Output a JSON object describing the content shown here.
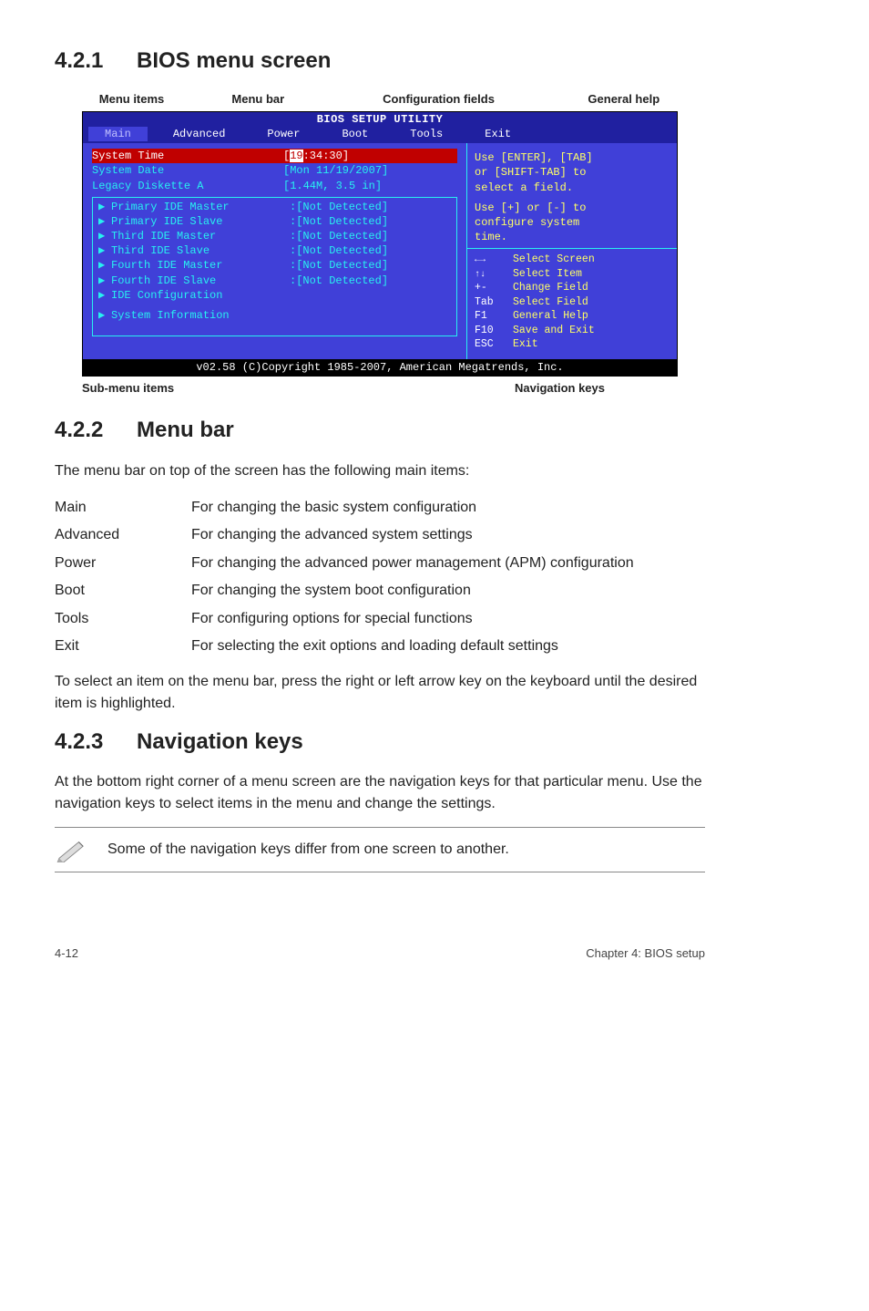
{
  "sections": {
    "s1": {
      "num": "4.2.1",
      "title": "BIOS menu screen"
    },
    "s2": {
      "num": "4.2.2",
      "title": "Menu bar"
    },
    "s3": {
      "num": "4.2.3",
      "title": "Navigation keys"
    }
  },
  "diagram_labels": {
    "menu_items": "Menu items",
    "menu_bar": "Menu bar",
    "config_fields": "Configuration fields",
    "general_help": "General help",
    "sub_menu_items": "Sub-menu items",
    "nav_keys": "Navigation keys"
  },
  "bios": {
    "header": "BIOS SETUP UTILITY",
    "menubar": [
      "Main",
      "Advanced",
      "Power",
      "Boot",
      "Tools",
      "Exit"
    ],
    "left": {
      "sys_time_label": "System Time",
      "sys_time_value_pre": "[",
      "sys_time_hl": "19",
      "sys_time_value_post": ":34:30]",
      "sys_date_label": "System Date",
      "sys_date_value": "[Mon 11/19/2007]",
      "legacy_label": "Legacy Diskette A",
      "legacy_value": "[1.44M, 3.5 in]",
      "ide_items": [
        {
          "label": "Primary IDE Master",
          "value": ":[Not Detected]"
        },
        {
          "label": "Primary IDE Slave",
          "value": ":[Not Detected]"
        },
        {
          "label": "Third IDE Master",
          "value": ":[Not Detected]"
        },
        {
          "label": "Third IDE Slave",
          "value": ":[Not Detected]"
        },
        {
          "label": "Fourth IDE Master",
          "value": ":[Not Detected]"
        },
        {
          "label": "Fourth IDE Slave",
          "value": ":[Not Detected]"
        }
      ],
      "ide_config": "IDE Configuration",
      "sys_info": "System Information"
    },
    "right_help": {
      "l1": "Use [ENTER], [TAB]",
      "l2": "or [SHIFT-TAB] to",
      "l3": "select a field.",
      "l4": "Use [+] or [-] to",
      "l5": "configure system",
      "l6": "time."
    },
    "right_nav": [
      {
        "key": "←→",
        "txt": "Select Screen"
      },
      {
        "key": "↑↓",
        "txt": "Select Item"
      },
      {
        "key": "+-",
        "txt": "Change Field"
      },
      {
        "key": "Tab",
        "txt": "Select Field"
      },
      {
        "key": "F1",
        "txt": "General Help"
      },
      {
        "key": "F10",
        "txt": "Save and Exit"
      },
      {
        "key": "ESC",
        "txt": "Exit"
      }
    ],
    "footer": "v02.58 (C)Copyright 1985-2007, American Megatrends, Inc."
  },
  "s2_intro": "The menu bar on top of the screen has the following main items:",
  "menu_desc": [
    {
      "term": "Main",
      "def": "For changing the basic system configuration"
    },
    {
      "term": "Advanced",
      "def": "For changing the advanced system settings"
    },
    {
      "term": "Power",
      "def": "For changing the advanced power management (APM) configuration"
    },
    {
      "term": "Boot",
      "def": "For changing the system boot configuration"
    },
    {
      "term": "Tools",
      "def": "For configuring options for special functions"
    },
    {
      "term": "Exit",
      "def": "For selecting the exit options and loading default settings"
    }
  ],
  "s2_outro": "To select an item on the menu bar, press the right or left arrow key on the keyboard until the desired item is highlighted.",
  "s3_body": "At the bottom right corner of a menu screen are the navigation keys for that particular menu. Use the navigation keys to select items in the menu and change the settings.",
  "note": "Some of the navigation keys differ from one screen to another.",
  "footer": {
    "left": "4-12",
    "right": "Chapter 4: BIOS setup"
  }
}
